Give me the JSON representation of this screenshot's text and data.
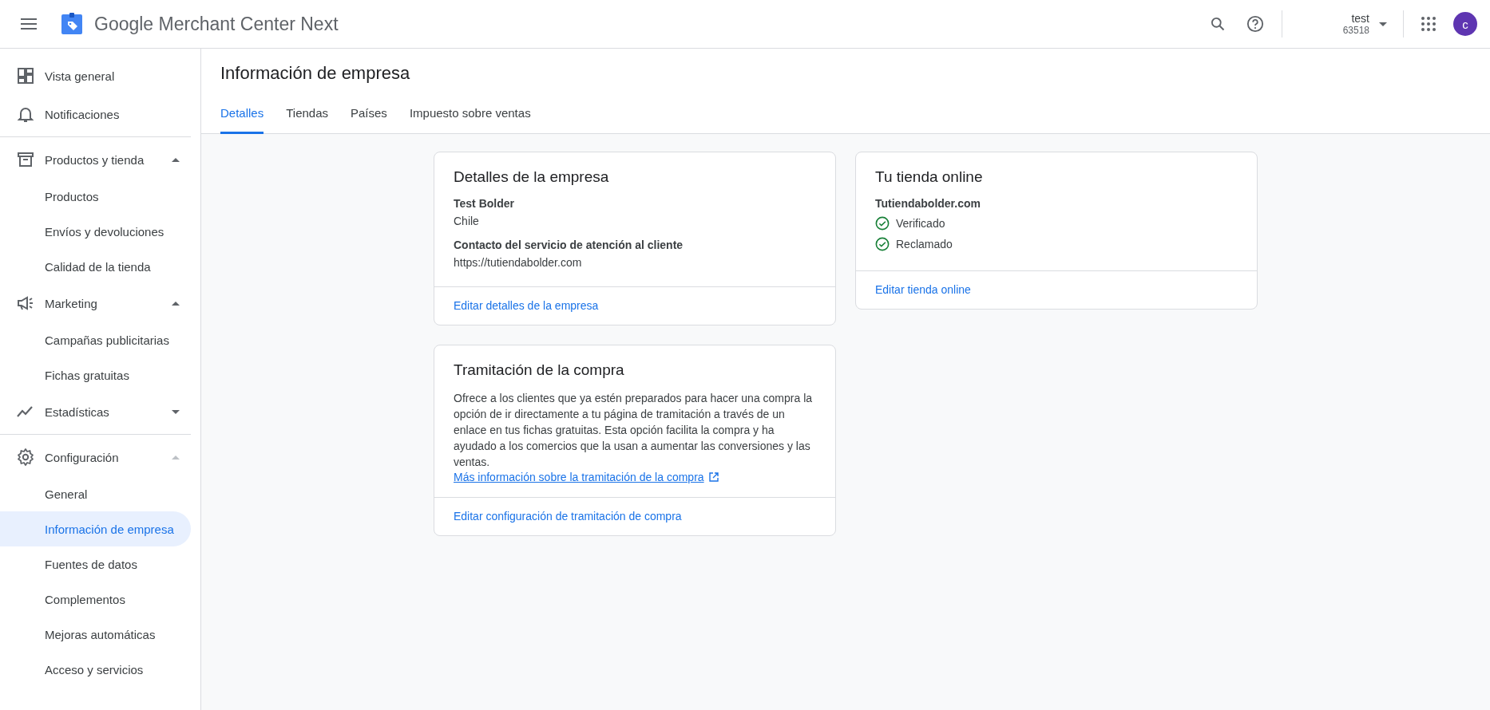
{
  "app": {
    "title": "Google Merchant Center Next",
    "account_name": "test",
    "account_id": "63518",
    "avatar_letter": "c"
  },
  "sidebar": {
    "groups": [
      {
        "items": [
          {
            "kind": "link",
            "label": "Vista general",
            "selected": false
          },
          {
            "kind": "link",
            "label": "Notificaciones",
            "selected": false
          }
        ]
      },
      {
        "items": [
          {
            "kind": "section",
            "label": "Productos y tienda",
            "expanded": true,
            "disabled": false,
            "children": [
              {
                "label": "Productos",
                "selected": false
              },
              {
                "label": "Envíos y devoluciones",
                "selected": false
              },
              {
                "label": "Calidad de la tienda",
                "selected": false
              }
            ]
          },
          {
            "kind": "section",
            "label": "Marketing",
            "expanded": true,
            "disabled": false,
            "children": [
              {
                "label": "Campañas publicitarias",
                "selected": false
              },
              {
                "label": "Fichas gratuitas",
                "selected": false
              }
            ]
          },
          {
            "kind": "section",
            "label": "Estadísticas",
            "expanded": false,
            "disabled": false
          }
        ]
      },
      {
        "items": [
          {
            "kind": "section",
            "label": "Configuración",
            "expanded": true,
            "disabled": true,
            "children": [
              {
                "label": "General",
                "selected": false
              },
              {
                "label": "Información de empresa",
                "selected": true
              },
              {
                "label": "Fuentes de datos",
                "selected": false
              },
              {
                "label": "Complementos",
                "selected": false
              },
              {
                "label": "Mejoras automáticas",
                "selected": false
              },
              {
                "label": "Acceso y servicios",
                "selected": false
              }
            ]
          }
        ]
      }
    ]
  },
  "page": {
    "title": "Información de empresa",
    "tabs": [
      {
        "label": "Detalles",
        "selected": true
      },
      {
        "label": "Tiendas",
        "selected": false
      },
      {
        "label": "Países",
        "selected": false
      },
      {
        "label": "Impuesto sobre ventas",
        "selected": false
      }
    ],
    "columns": [
      [
        {
          "title": "Detalles de la empresa",
          "lines": [
            {
              "kind": "label",
              "text": "Test Bolder"
            },
            {
              "kind": "value",
              "text": "Chile"
            },
            {
              "kind": "label",
              "text": "Contacto del servicio de atención al cliente"
            },
            {
              "kind": "value",
              "text": "https://tutiendabolder.com"
            }
          ],
          "action": "Editar detalles de la empresa"
        },
        {
          "title": "Tramitación de la compra",
          "lines": [
            {
              "kind": "paragraph",
              "text": "Ofrece a los clientes que ya estén preparados para hacer una compra la opción de ir directamente a tu página de tramitación a través de un enlace en tus fichas gratuitas. Esta opción facilita la compra y ha ayudado a los comercios que la usan a aumentar las conversiones y las ventas."
            },
            {
              "kind": "link",
              "text": "Más información sobre la tramitación de la compra"
            }
          ],
          "action": "Editar configuración de tramitación de compra"
        }
      ],
      [
        {
          "title": "Tu tienda online",
          "lines": [
            {
              "kind": "label",
              "text": "Tutiendabolder.com"
            },
            {
              "kind": "status",
              "text": "Verificado",
              "ok": true
            },
            {
              "kind": "status",
              "text": "Reclamado",
              "ok": true
            }
          ],
          "action": "Editar tienda online"
        }
      ]
    ]
  }
}
